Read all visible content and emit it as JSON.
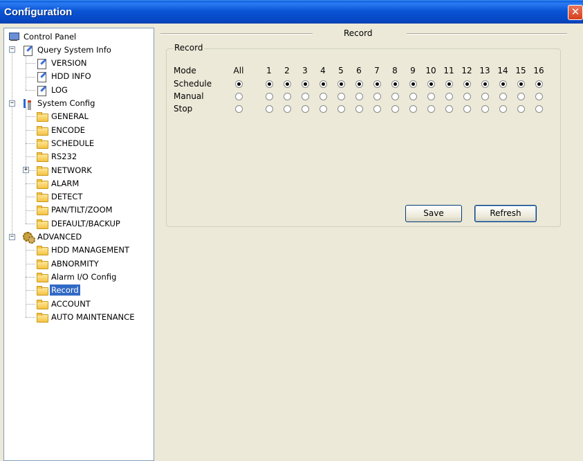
{
  "window": {
    "title": "Configuration",
    "close_label": "✕"
  },
  "tree": {
    "items": [
      {
        "label": "Control Panel",
        "icon": "computer-icon"
      },
      {
        "label": "Query System Info",
        "icon": "doc-icon",
        "expander": "−"
      },
      {
        "label": "VERSION",
        "icon": "doc-icon"
      },
      {
        "label": "HDD INFO",
        "icon": "doc-icon"
      },
      {
        "label": "LOG",
        "icon": "doc-icon"
      },
      {
        "label": "System Config",
        "icon": "tools-icon",
        "expander": "−"
      },
      {
        "label": "GENERAL",
        "icon": "folder-icon"
      },
      {
        "label": "ENCODE",
        "icon": "folder-icon"
      },
      {
        "label": "SCHEDULE",
        "icon": "folder-icon"
      },
      {
        "label": "RS232",
        "icon": "folder-icon"
      },
      {
        "label": "NETWORK",
        "icon": "folder-icon",
        "expander": "+"
      },
      {
        "label": "ALARM",
        "icon": "folder-icon"
      },
      {
        "label": "DETECT",
        "icon": "folder-icon"
      },
      {
        "label": "PAN/TILT/ZOOM",
        "icon": "folder-icon"
      },
      {
        "label": "DEFAULT/BACKUP",
        "icon": "folder-icon"
      },
      {
        "label": "ADVANCED",
        "icon": "gears-icon",
        "expander": "−"
      },
      {
        "label": "HDD MANAGEMENT",
        "icon": "folder-icon"
      },
      {
        "label": "ABNORMITY",
        "icon": "folder-icon"
      },
      {
        "label": "Alarm I/O Config",
        "icon": "folder-icon"
      },
      {
        "label": "Record",
        "icon": "folder-icon",
        "selected": true
      },
      {
        "label": "ACCOUNT",
        "icon": "folder-icon"
      },
      {
        "label": "AUTO MAINTENANCE",
        "icon": "folder-icon"
      }
    ]
  },
  "main": {
    "group_title": "Record",
    "record_legend": "Record",
    "mode_label": "Mode",
    "columns": [
      "All",
      "1",
      "2",
      "3",
      "4",
      "5",
      "6",
      "7",
      "8",
      "9",
      "10",
      "11",
      "12",
      "13",
      "14",
      "15",
      "16"
    ],
    "rows": [
      {
        "label": "Schedule",
        "checked": true
      },
      {
        "label": "Manual",
        "checked": false
      },
      {
        "label": "Stop",
        "checked": false
      }
    ],
    "save_label": "Save",
    "refresh_label": "Refresh"
  }
}
